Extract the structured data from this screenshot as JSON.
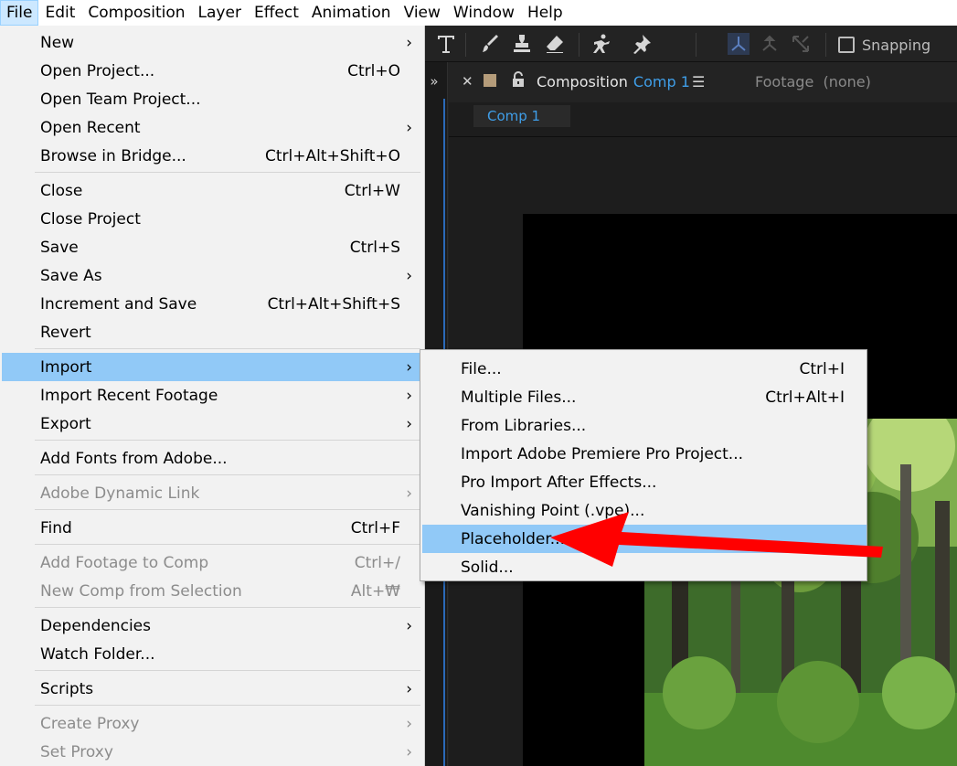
{
  "menubar": {
    "items": [
      "File",
      "Edit",
      "Composition",
      "Layer",
      "Effect",
      "Animation",
      "View",
      "Window",
      "Help"
    ]
  },
  "toolbar": {
    "tools": [
      "type-tool",
      "brush-tool",
      "clone-stamp-tool",
      "eraser-tool",
      "roto-brush-tool",
      "puppet-pin-tool",
      "axis-mode-local",
      "axis-mode-world",
      "axis-mode-view"
    ],
    "snapping_label": "Snapping"
  },
  "panel": {
    "tab_title": "Composition",
    "comp_name": "Comp 1",
    "footage_tab": "Footage",
    "footage_value": "(none)",
    "subtab": "Comp 1",
    "label_color": "#b59c7a"
  },
  "file_menu": {
    "new": "New",
    "open_project": "Open Project...",
    "open_project_sc": "Ctrl+O",
    "open_team_project": "Open Team Project...",
    "open_recent": "Open Recent",
    "browse_bridge": "Browse in Bridge...",
    "browse_bridge_sc": "Ctrl+Alt+Shift+O",
    "close": "Close",
    "close_sc": "Ctrl+W",
    "close_project": "Close Project",
    "save": "Save",
    "save_sc": "Ctrl+S",
    "save_as": "Save As",
    "increment_save": "Increment and Save",
    "increment_save_sc": "Ctrl+Alt+Shift+S",
    "revert": "Revert",
    "import": "Import",
    "import_recent": "Import Recent Footage",
    "export": "Export",
    "add_fonts": "Add Fonts from Adobe...",
    "dynamic_link": "Adobe Dynamic Link",
    "find": "Find",
    "find_sc": "Ctrl+F",
    "add_footage": "Add Footage to Comp",
    "add_footage_sc": "Ctrl+/",
    "new_comp_sel": "New Comp from Selection",
    "new_comp_sel_sc": "Alt+₩",
    "dependencies": "Dependencies",
    "watch_folder": "Watch Folder...",
    "scripts": "Scripts",
    "create_proxy": "Create Proxy",
    "set_proxy": "Set Proxy",
    "arrow": "›"
  },
  "import_menu": {
    "file": "File...",
    "file_sc": "Ctrl+I",
    "multiple": "Multiple Files...",
    "multiple_sc": "Ctrl+Alt+I",
    "libraries": "From Libraries...",
    "premiere": "Import Adobe Premiere Pro Project...",
    "pro_import": "Pro Import After Effects...",
    "vanishing": "Vanishing Point (.vpe)...",
    "placeholder": "Placeholder...",
    "solid": "Solid..."
  },
  "colors": {
    "highlight": "#91c9f7",
    "accent_blue": "#3f9ee8",
    "annotation_red": "#ff0000"
  }
}
